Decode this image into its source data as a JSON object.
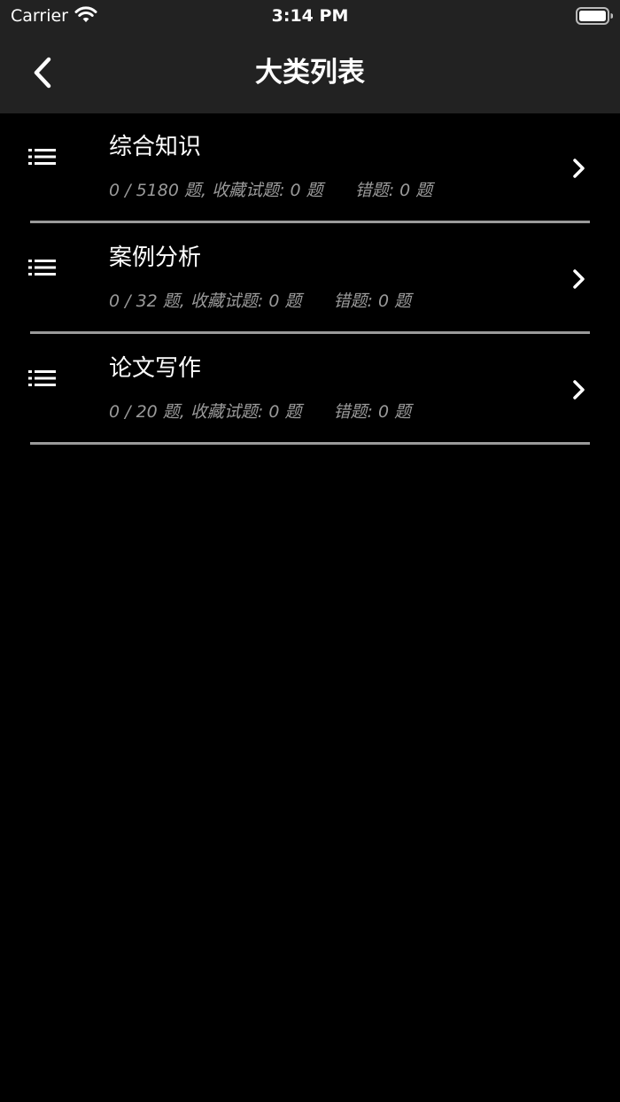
{
  "status_bar": {
    "carrier": "Carrier",
    "time": "3:14 PM",
    "wifi_icon": "wifi-icon",
    "battery_icon": "battery-full-icon"
  },
  "nav": {
    "title": "大类列表",
    "back_icon": "chevron-left-icon"
  },
  "items": [
    {
      "title": "综合知识",
      "progress": "0 / 5180 题,",
      "favorites": "收藏试题: 0 题",
      "wrong": "错题: 0 题",
      "icon": "list-icon"
    },
    {
      "title": "案例分析",
      "progress": "0 / 32 题,",
      "favorites": "收藏试题: 0 题",
      "wrong": "错题: 0 题",
      "icon": "list-icon"
    },
    {
      "title": "论文写作",
      "progress": "0 / 20 题,",
      "favorites": "收藏试题: 0 题",
      "wrong": "错题: 0 题",
      "icon": "list-icon"
    }
  ],
  "colors": {
    "background": "#000000",
    "bar_background": "#222222",
    "text_primary": "#ffffff",
    "text_secondary": "#9a9a9a",
    "divider": "#9a9a9a"
  }
}
